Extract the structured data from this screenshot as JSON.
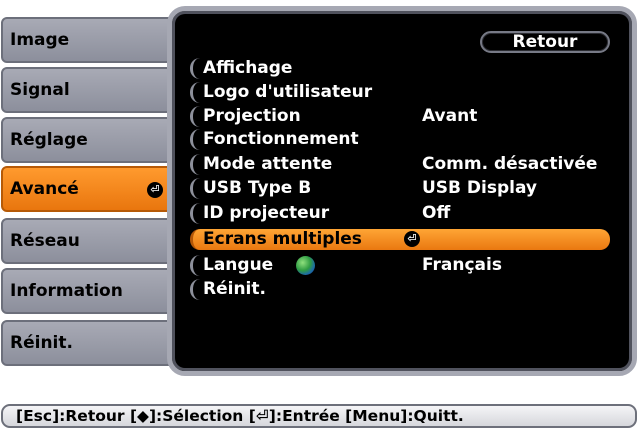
{
  "tabs": [
    {
      "label": "Image"
    },
    {
      "label": "Signal"
    },
    {
      "label": "Réglage"
    },
    {
      "label": "Avancé",
      "active": true
    },
    {
      "label": "Réseau"
    },
    {
      "label": "Information"
    },
    {
      "label": "Réinit."
    }
  ],
  "panel": {
    "back_label": "Retour",
    "rows": [
      {
        "label": "Affichage",
        "value": ""
      },
      {
        "label": "Logo d'utilisateur",
        "value": ""
      },
      {
        "label": "Projection",
        "value": "Avant"
      },
      {
        "label": "Fonctionnement",
        "value": ""
      },
      {
        "label": "Mode attente",
        "value": "Comm. désactivée"
      },
      {
        "label": "USB Type B",
        "value": "USB Display"
      },
      {
        "label": "ID projecteur",
        "value": "Off"
      },
      {
        "label": "Ecrans multiples",
        "value": "",
        "selected": true
      },
      {
        "label": "Langue",
        "value": "Français"
      },
      {
        "label": "Réinit.",
        "value": ""
      }
    ]
  },
  "footer": {
    "text": "[Esc]:Retour [◆]:Sélection [⏎]:Entrée [Menu]:Quitt."
  },
  "colors": {
    "accent": "#f28a1e",
    "panel_bg": "#000000",
    "tab_bg": "#9b9ea9"
  },
  "icons": {
    "enter": "enter-icon",
    "globe": "globe-icon"
  }
}
